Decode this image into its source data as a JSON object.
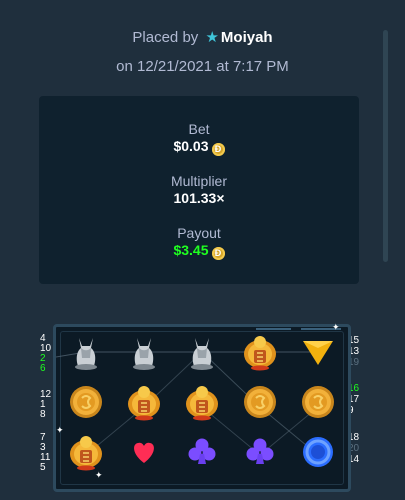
{
  "header": {
    "placed_by_label": "Placed by",
    "username": "Moiyah",
    "date_text": "on 12/21/2021 at 7:17 PM"
  },
  "stats": {
    "bet_label": "Bet",
    "bet_value": "$0.03",
    "multiplier_label": "Multiplier",
    "multiplier_value": "101.33×",
    "payout_label": "Payout",
    "payout_value": "$3.45",
    "currency_symbol": "Đ",
    "payout_color": "#1fff20"
  },
  "board": {
    "rows": [
      [
        "jackal-statue",
        "jackal-statue",
        "jackal-statue",
        "scarab-gold",
        "triangle-gem"
      ],
      [
        "gold-coin",
        "scarab-gold",
        "scarab-gold",
        "gold-coin",
        "gold-coin"
      ],
      [
        "scarab-gold",
        "heart-gem",
        "club-gem",
        "club-gem",
        "blue-ring"
      ]
    ],
    "left_lines": [
      [
        "4",
        "10",
        "2",
        "6"
      ],
      [
        "12",
        "1",
        "8"
      ],
      [
        "7",
        "3",
        "11",
        "5"
      ]
    ],
    "right_lines": [
      [
        "15",
        "13",
        "19"
      ],
      [
        "16",
        "17",
        "9"
      ],
      [
        "18",
        "20",
        "14"
      ]
    ]
  }
}
